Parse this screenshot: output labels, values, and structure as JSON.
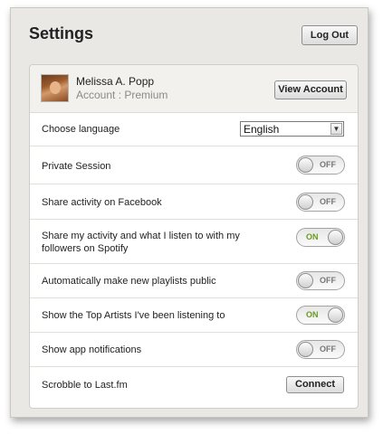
{
  "header": {
    "title": "Settings",
    "logout_label": "Log Out"
  },
  "account": {
    "name": "Melissa A. Popp",
    "type": "Account : Premium",
    "view_account_label": "View Account"
  },
  "language": {
    "label": "Choose language",
    "selected": "English"
  },
  "settings": [
    {
      "label": "Private Session",
      "state": "OFF"
    },
    {
      "label": "Share activity on Facebook",
      "state": "OFF"
    },
    {
      "label": "Share my activity and what I listen to with my",
      "label2": "followers on Spotify",
      "state": "ON"
    },
    {
      "label": "Automatically make new playlists public",
      "state": "OFF"
    },
    {
      "label": "Show the Top Artists I've been listening to",
      "state": "ON"
    },
    {
      "label": "Show app notifications",
      "state": "OFF"
    }
  ],
  "scrobble": {
    "label": "Scrobble to Last.fm",
    "connect_label": "Connect"
  },
  "icons": {
    "avatar": "user-avatar",
    "dropdown": "chevron-down-icon"
  },
  "colors": {
    "toggle_on_text": "#6a9a1c",
    "panel_bg": "#e9e8e5"
  }
}
